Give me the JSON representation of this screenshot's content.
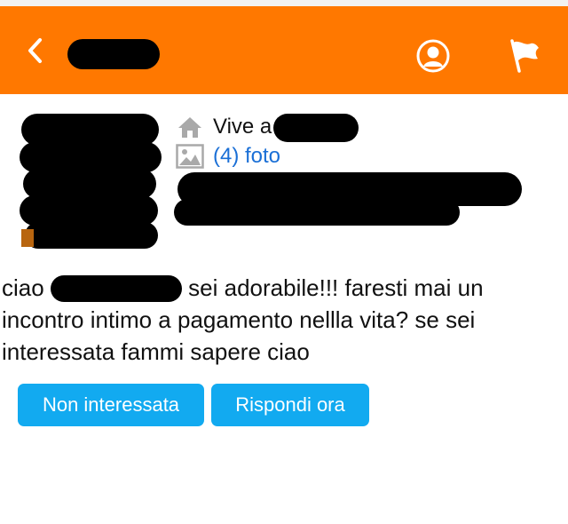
{
  "header": {
    "background_color": "#ff7800",
    "back_icon": "chevron-left-icon",
    "profile_icon": "user-icon",
    "report_icon": "flag-icon"
  },
  "profile": {
    "lives_prefix": "Vive a",
    "photos_label": "(4) foto",
    "home_icon": "home-icon",
    "photos_icon": "image-icon",
    "link_color": "#1a6fd6"
  },
  "message": {
    "greeting": "ciao",
    "body": "sei adorabile!!! faresti mai un incontro intimo a pagamento nellla vita? se sei interessata fammi sapere ciao"
  },
  "actions": {
    "decline_label": "Non interessata",
    "reply_label": "Rispondi ora",
    "button_color": "#12aaf0"
  }
}
